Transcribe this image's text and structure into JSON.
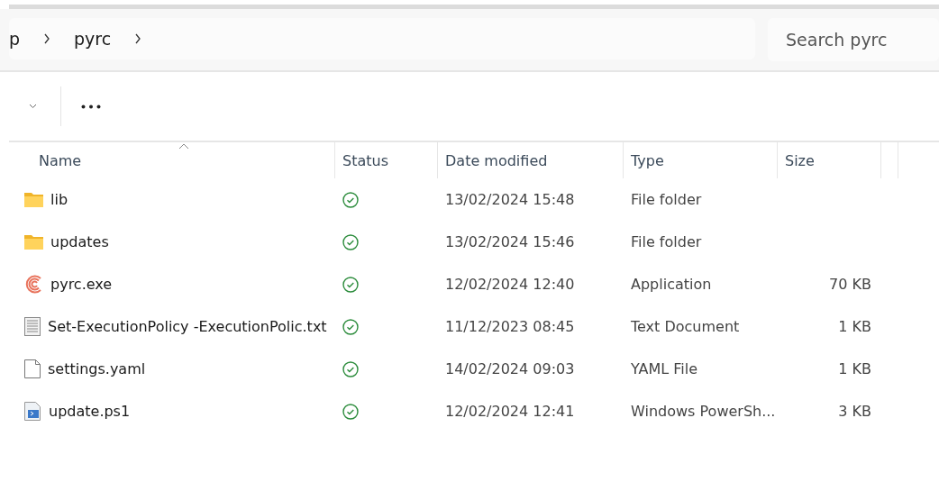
{
  "address_bar": {
    "crumbs": [
      "p",
      "pyrc"
    ]
  },
  "search": {
    "placeholder": "Search pyrc"
  },
  "table": {
    "columns": [
      {
        "label": "Name",
        "sorted": true
      },
      {
        "label": "Status",
        "sorted": false
      },
      {
        "label": "Date modified",
        "sorted": false
      },
      {
        "label": "Type",
        "sorted": false
      },
      {
        "label": "Size",
        "sorted": false
      }
    ],
    "rows": [
      {
        "kind": "folder",
        "name": "lib",
        "synced": true,
        "date": "13/02/2024 15:48",
        "type": "File folder",
        "size": ""
      },
      {
        "kind": "folder",
        "name": "updates",
        "synced": true,
        "date": "13/02/2024 15:46",
        "type": "File folder",
        "size": ""
      },
      {
        "kind": "app",
        "name": "pyrc.exe",
        "synced": true,
        "date": "12/02/2024 12:40",
        "type": "Application",
        "size": "70 KB"
      },
      {
        "kind": "text",
        "name": "Set-ExecutionPolicy -ExecutionPolic.txt",
        "synced": true,
        "date": "11/12/2023 08:45",
        "type": "Text Document",
        "size": "1 KB"
      },
      {
        "kind": "file",
        "name": "settings.yaml",
        "synced": true,
        "date": "14/02/2024 09:03",
        "type": "YAML File",
        "size": "1 KB"
      },
      {
        "kind": "script",
        "name": "update.ps1",
        "synced": true,
        "date": "12/02/2024 12:41",
        "type": "Windows PowerSh...",
        "size": "3 KB"
      }
    ]
  }
}
